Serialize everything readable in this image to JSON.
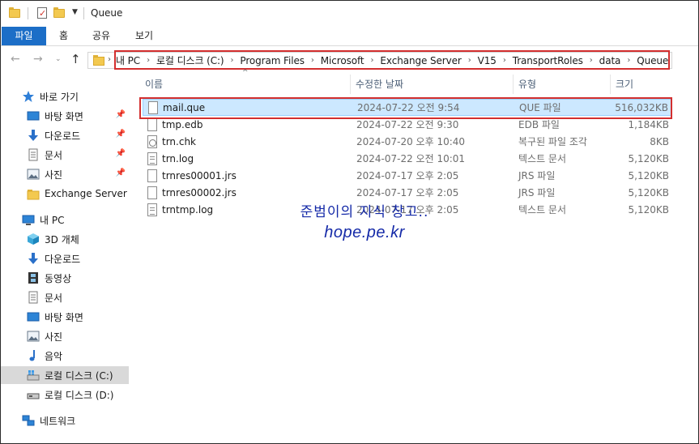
{
  "window": {
    "title": "Queue"
  },
  "ribbon": {
    "tabs": [
      {
        "label": "파일"
      },
      {
        "label": "홈"
      },
      {
        "label": "공유"
      },
      {
        "label": "보기"
      }
    ]
  },
  "address": {
    "breadcrumbs": [
      "내 PC",
      "로컬 디스크 (C:)",
      "Program Files",
      "Microsoft",
      "Exchange Server",
      "V15",
      "TransportRoles",
      "data",
      "Queue"
    ]
  },
  "sidebar": {
    "quick_access": {
      "label": "바로 가기",
      "items": [
        {
          "label": "바탕 화면",
          "pinned": true
        },
        {
          "label": "다운로드",
          "pinned": true
        },
        {
          "label": "문서",
          "pinned": true
        },
        {
          "label": "사진",
          "pinned": true
        },
        {
          "label": "Exchange Server",
          "pinned": false
        }
      ]
    },
    "this_pc": {
      "label": "내 PC",
      "items": [
        {
          "label": "3D 개체"
        },
        {
          "label": "다운로드"
        },
        {
          "label": "동영상"
        },
        {
          "label": "문서"
        },
        {
          "label": "바탕 화면"
        },
        {
          "label": "사진"
        },
        {
          "label": "음악"
        },
        {
          "label": "로컬 디스크 (C:)",
          "selected": true
        },
        {
          "label": "로컬 디스크 (D:)"
        }
      ]
    },
    "network": {
      "label": "네트워크"
    }
  },
  "file_list": {
    "columns": {
      "name": "이름",
      "date": "수정한 날짜",
      "type": "유형",
      "size": "크기"
    },
    "rows": [
      {
        "name": "mail.que",
        "date": "2024-07-22 오전 9:54",
        "type": "QUE 파일",
        "size": "516,032KB",
        "icon": "blank-file-icon",
        "selected": true
      },
      {
        "name": "tmp.edb",
        "date": "2024-07-22 오전 9:30",
        "type": "EDB 파일",
        "size": "1,184KB",
        "icon": "blank-file-icon"
      },
      {
        "name": "trn.chk",
        "date": "2024-07-20 오후 10:40",
        "type": "복구된 파일 조각",
        "size": "8KB",
        "icon": "chk-file-icon"
      },
      {
        "name": "trn.log",
        "date": "2024-07-22 오전 10:01",
        "type": "텍스트 문서",
        "size": "5,120KB",
        "icon": "text-file-icon"
      },
      {
        "name": "trnres00001.jrs",
        "date": "2024-07-17 오후 2:05",
        "type": "JRS 파일",
        "size": "5,120KB",
        "icon": "blank-file-icon"
      },
      {
        "name": "trnres00002.jrs",
        "date": "2024-07-17 오후 2:05",
        "type": "JRS 파일",
        "size": "5,120KB",
        "icon": "blank-file-icon"
      },
      {
        "name": "trntmp.log",
        "date": "2024-07-17 오후 2:05",
        "type": "텍스트 문서",
        "size": "5,120KB",
        "icon": "text-file-icon"
      }
    ]
  },
  "watermark": {
    "line1": "준범이의 지식 창고..",
    "line2": "hope.pe.kr"
  },
  "colors": {
    "accent": "#1c6ec7",
    "highlight_box": "#d32f2f",
    "selection": "#cce8ff",
    "watermark": "#152aa8"
  }
}
